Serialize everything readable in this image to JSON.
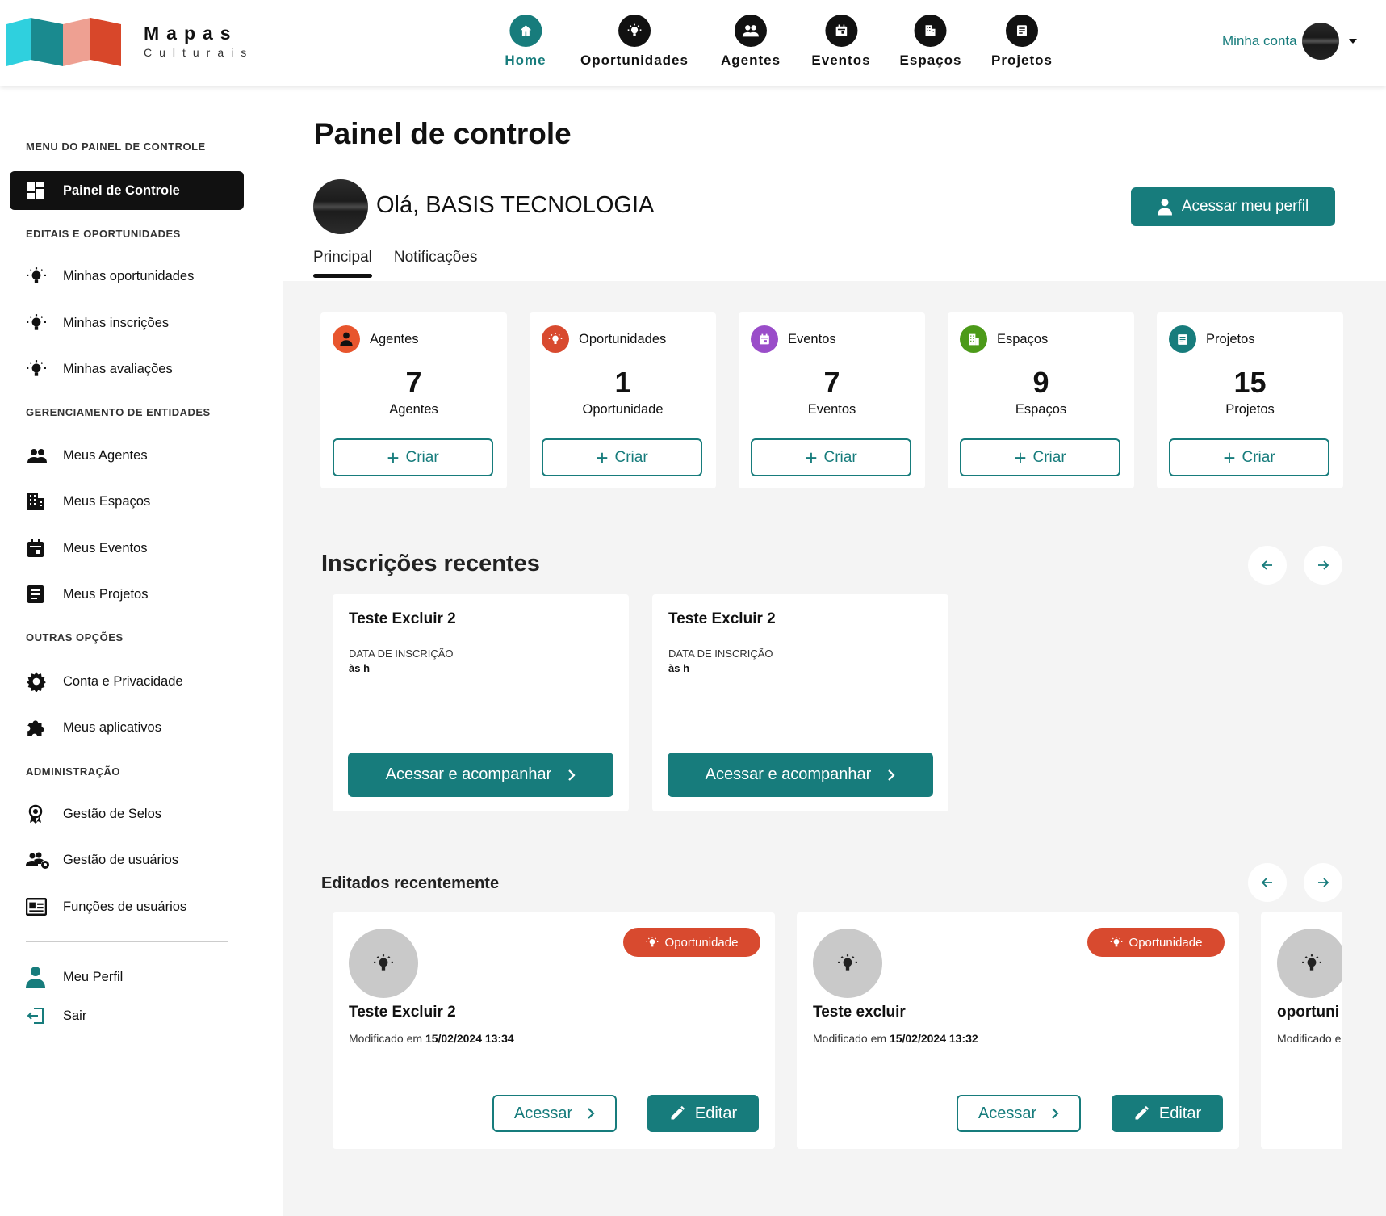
{
  "header": {
    "logo_line1": "Mapas",
    "logo_line2": "Culturais",
    "nav": [
      {
        "label": "Home",
        "icon": "home-icon",
        "active": true
      },
      {
        "label": "Oportunidades",
        "icon": "lightbulb-icon"
      },
      {
        "label": "Agentes",
        "icon": "people-icon"
      },
      {
        "label": "Eventos",
        "icon": "calendar-icon"
      },
      {
        "label": "Espaços",
        "icon": "building-icon"
      },
      {
        "label": "Projetos",
        "icon": "document-icon"
      }
    ],
    "account_label": "Minha conta"
  },
  "sidebar": {
    "title_menu": "MENU DO PAINEL DE CONTROLE",
    "active_item": "Painel de Controle",
    "title_editais": "EDITAIS E OPORTUNIDADES",
    "editais": [
      "Minhas oportunidades",
      "Minhas inscrições",
      "Minhas avaliações"
    ],
    "title_entidades": "GERENCIAMENTO DE ENTIDADES",
    "entidades": [
      "Meus Agentes",
      "Meus Espaços",
      "Meus Eventos",
      "Meus Projetos"
    ],
    "title_outras": "OUTRAS OPÇÕES",
    "outras": [
      "Conta e Privacidade",
      "Meus aplicativos"
    ],
    "title_admin": "ADMINISTRAÇÃO",
    "admin": [
      "Gestão de Selos",
      "Gestão de usuários",
      "Funções de usuários"
    ],
    "perfil": "Meu Perfil",
    "sair": "Sair"
  },
  "main": {
    "title": "Painel de controle",
    "greeting": "Olá, BASIS TECNOLOGIA",
    "profile_button": "Acessar meu perfil",
    "tabs": [
      "Principal",
      "Notificações"
    ],
    "active_tab": "Principal"
  },
  "entity_cards": [
    {
      "name": "Agentes",
      "count": "7",
      "unit": "Agentes",
      "button": "Criar",
      "color": "#e8552d"
    },
    {
      "name": "Oportunidades",
      "count": "1",
      "unit": "Oportunidade",
      "button": "Criar",
      "color": "#d84a2f"
    },
    {
      "name": "Eventos",
      "count": "7",
      "unit": "Eventos",
      "button": "Criar",
      "color": "#9a4dc9"
    },
    {
      "name": "Espaços",
      "count": "9",
      "unit": "Espaços",
      "button": "Criar",
      "color": "#4c9a19"
    },
    {
      "name": "Projetos",
      "count": "15",
      "unit": "Projetos",
      "button": "Criar",
      "color": "#177c7c"
    }
  ],
  "inscricoes": {
    "title": "Inscrições recentes",
    "items": [
      {
        "title": "Teste Excluir 2",
        "label": "DATA DE INSCRIÇÃO",
        "value": "às h",
        "button": "Acessar e acompanhar"
      },
      {
        "title": "Teste Excluir 2",
        "label": "DATA DE INSCRIÇÃO",
        "value": "às h",
        "button": "Acessar e acompanhar"
      }
    ]
  },
  "editados": {
    "title": "Editados recentemente",
    "items": [
      {
        "badge": "Oportunidade",
        "title": "Teste Excluir 2",
        "mod_prefix": "Modificado em",
        "mod_date": "15/02/2024 13:34",
        "access": "Acessar",
        "edit": "Editar"
      },
      {
        "badge": "Oportunidade",
        "title": "Teste excluir",
        "mod_prefix": "Modificado em",
        "mod_date": "15/02/2024 13:32",
        "access": "Acessar",
        "edit": "Editar"
      },
      {
        "title": "oportuni",
        "mod_prefix": "Modificado e"
      }
    ]
  },
  "colors": {
    "accent": "#177c7c",
    "badge": "#d84a2f"
  }
}
